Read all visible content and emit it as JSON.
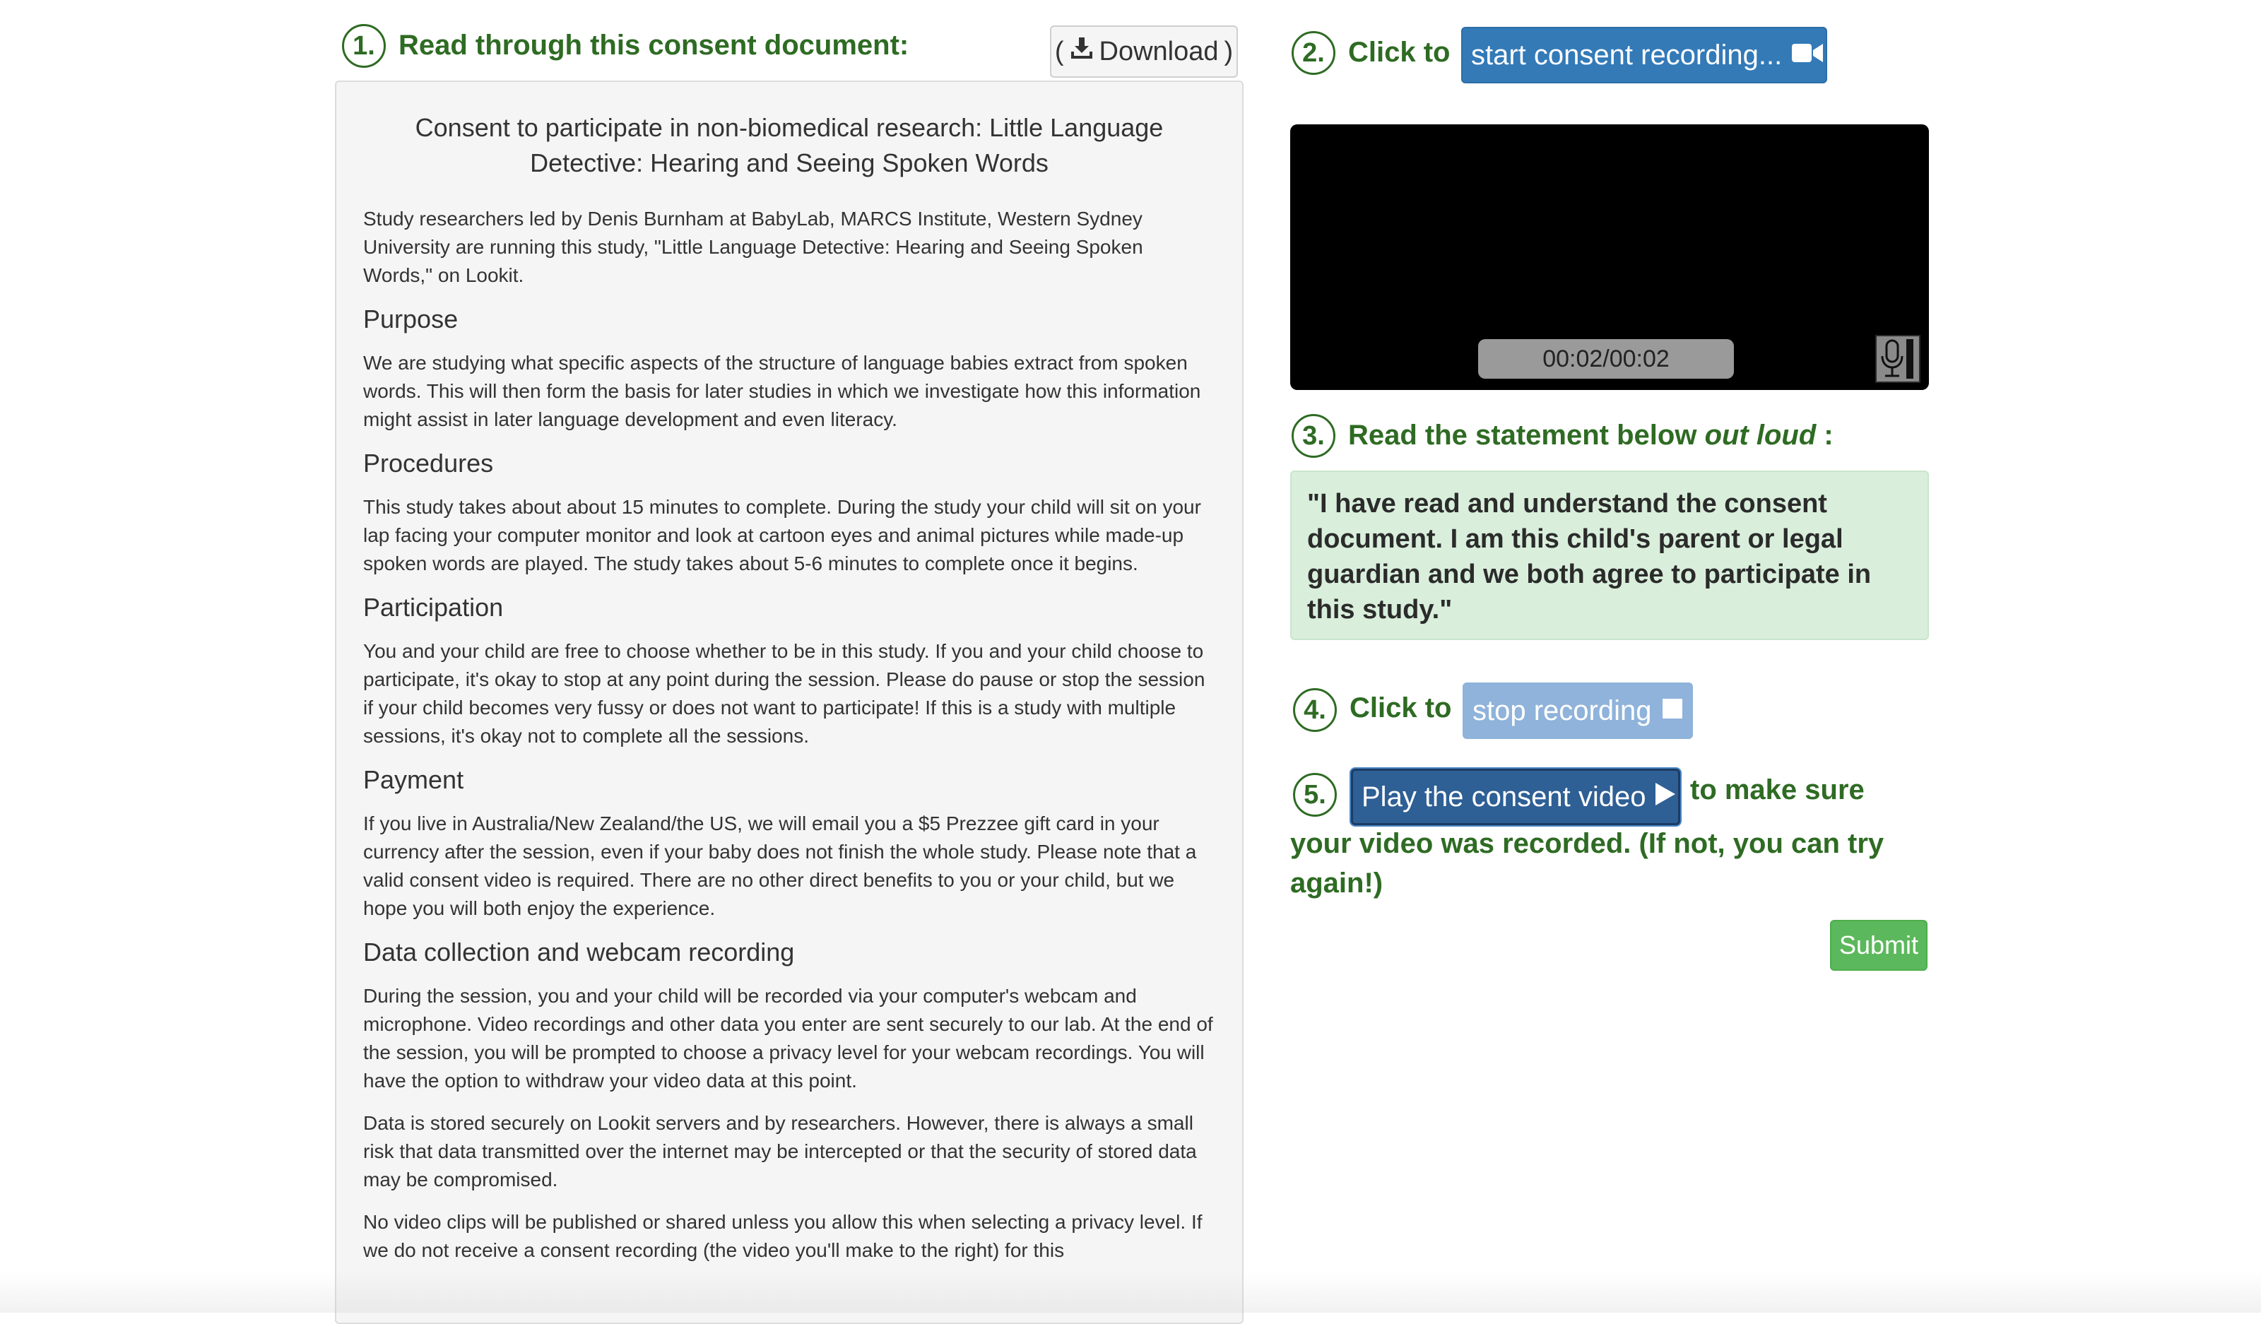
{
  "step1": {
    "number": "1.",
    "text": "Read through this consent document:"
  },
  "download": {
    "open_paren": "(",
    "label": "Download",
    "close_paren": ")",
    "icon": "download-icon"
  },
  "document": {
    "title": "Consent to participate in non-biomedical research: Little Language Detective: Hearing and Seeing Spoken Words",
    "intro": "Study researchers led by Denis Burnham at BabyLab, MARCS Institute, Western Sydney University are running this study, \"Little Language Detective: Hearing and Seeing Spoken Words,\" on Lookit.",
    "sections": [
      {
        "heading": "Purpose",
        "paragraphs": [
          "We are studying what specific aspects of the structure of language babies extract from spoken words. This will then form the basis for later studies in which we investigate how this information might assist in later language development and even literacy."
        ]
      },
      {
        "heading": "Procedures",
        "paragraphs": [
          "This study takes about about 15 minutes to complete. During the study your child will sit on your lap facing your computer monitor and look at cartoon eyes and animal pictures while made-up spoken words are played. The study takes about 5-6 minutes to complete once it begins."
        ]
      },
      {
        "heading": "Participation",
        "paragraphs": [
          "You and your child are free to choose whether to be in this study. If you and your child choose to participate, it's okay to stop at any point during the session. Please do pause or stop the session if your child becomes very fussy or does not want to participate! If this is a study with multiple sessions, it's okay not to complete all the sessions."
        ]
      },
      {
        "heading": "Payment",
        "paragraphs": [
          "If you live in Australia/New Zealand/the US, we will email you a $5 Prezzee gift card in your currency after the session, even if your baby does not finish the whole study. Please note that a valid consent video is required. There are no other direct benefits to you or your child, but we hope you will both enjoy the experience."
        ]
      },
      {
        "heading": "Data collection and webcam recording",
        "paragraphs": [
          "During the session, you and your child will be recorded via your computer's webcam and microphone. Video recordings and other data you enter are sent securely to our lab. At the end of the session, you will be prompted to choose a privacy level for your webcam recordings. You will have the option to withdraw your video data at this point.",
          "Data is stored securely on Lookit servers and by researchers. However, there is always a small risk that data transmitted over the internet may be intercepted or that the security of stored data may be compromised.",
          "No video clips will be published or shared unless you allow this when selecting a privacy level. If we do not receive a consent recording (the video you'll make to the right) for this"
        ]
      }
    ]
  },
  "step2": {
    "number": "2.",
    "text": "Click to"
  },
  "start_button": {
    "label": "start consent recording...",
    "icon": "video-camera-icon"
  },
  "video": {
    "timer": "00:02/00:02",
    "mic_icon": "microphone-icon"
  },
  "step3": {
    "number": "3.",
    "text_before": "Read the statement below ",
    "text_italic": "out loud",
    "text_after": " :"
  },
  "statement": "\"I have read and understand the consent document. I am this child's parent or legal guardian and we both agree to participate in this study.\"",
  "step4": {
    "number": "4.",
    "text": "Click to"
  },
  "stop_button": {
    "label": "stop recording",
    "icon": "stop-square-icon"
  },
  "step5": {
    "number": "5.",
    "text_after": "to make sure",
    "text_line2": "your video was recorded. (If not, you can try again!)"
  },
  "play_button": {
    "label": "Play the consent video",
    "icon": "play-icon"
  },
  "submit": {
    "label": "Submit"
  },
  "colors": {
    "step_green": "#2e6b23",
    "primary_blue": "#337ab7",
    "submit_green": "#5cb85c",
    "statement_bg": "#d9efdc"
  }
}
